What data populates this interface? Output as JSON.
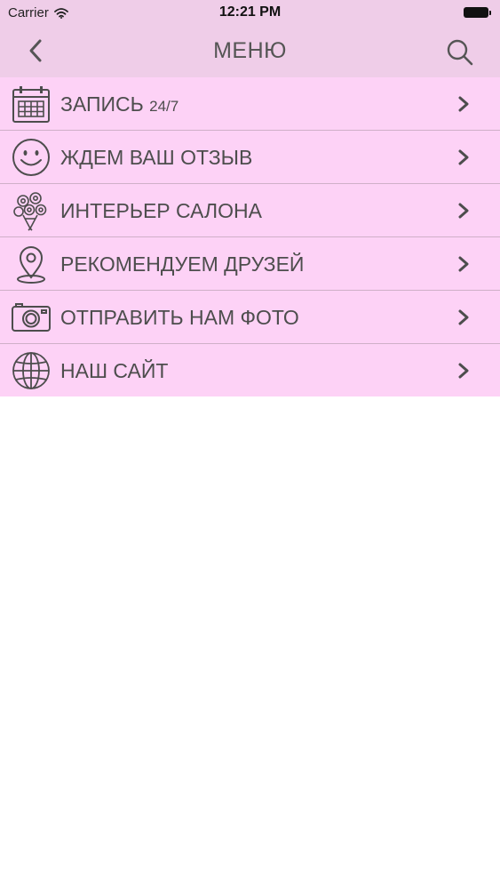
{
  "status_bar": {
    "carrier": "Carrier",
    "time": "12:21 PM",
    "wifi_icon": "wifi-icon",
    "battery_icon": "battery-icon"
  },
  "nav": {
    "title": "МЕНЮ",
    "back_icon": "chevron-left-icon",
    "search_icon": "search-icon"
  },
  "menu": {
    "items": [
      {
        "label": "ЗАПИСЬ",
        "suffix": "24/7",
        "icon": "calendar-icon"
      },
      {
        "label": "ЖДЕМ ВАШ ОТЗЫВ",
        "suffix": "",
        "icon": "smiley-icon"
      },
      {
        "label": "ИНТЕРЬЕР САЛОНА",
        "suffix": "",
        "icon": "flower-bouquet-icon"
      },
      {
        "label": "РЕКОМЕНДУЕМ ДРУЗЕЙ",
        "suffix": "",
        "icon": "location-pin-icon"
      },
      {
        "label": "ОТПРАВИТЬ НАМ ФОТО",
        "suffix": "",
        "icon": "camera-icon"
      },
      {
        "label": "НАШ САЙТ",
        "suffix": "",
        "icon": "globe-icon"
      }
    ]
  },
  "colors": {
    "header_bg": "#efcde8",
    "menu_bg": "#fdd2f6",
    "divider": "#cfb0c8",
    "text": "#4d4d4d"
  }
}
